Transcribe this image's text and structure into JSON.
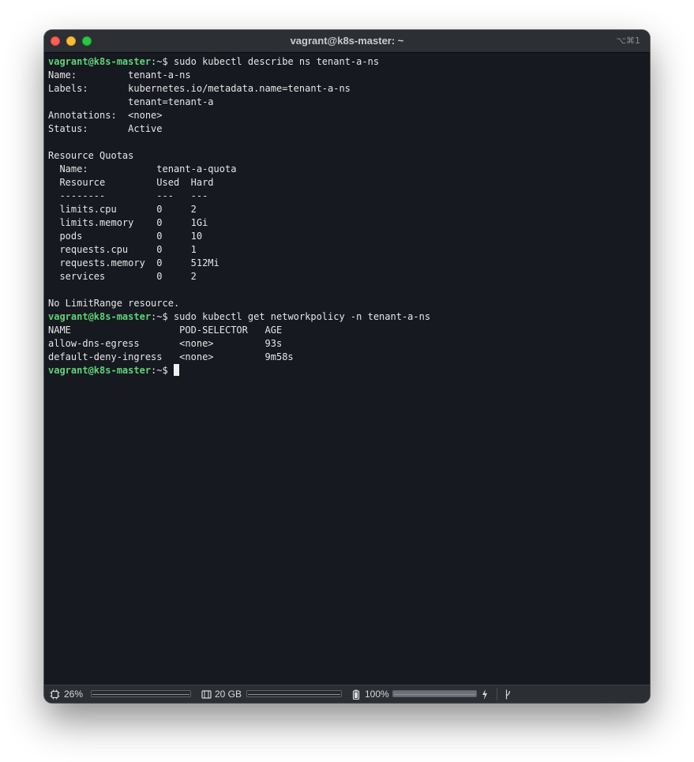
{
  "window": {
    "title": "vagrant@k8s-master: ~",
    "shortcut": "⌥⌘1"
  },
  "terminal": {
    "lines": [
      {
        "prompt": "vagrant@k8s-master",
        "path": ":~$ ",
        "command": "sudo kubectl describe ns tenant-a-ns"
      },
      {
        "text": "Name:         tenant-a-ns"
      },
      {
        "text": "Labels:       kubernetes.io/metadata.name=tenant-a-ns"
      },
      {
        "text": "              tenant=tenant-a"
      },
      {
        "text": "Annotations:  <none>"
      },
      {
        "text": "Status:       Active"
      },
      {
        "text": ""
      },
      {
        "text": "Resource Quotas"
      },
      {
        "text": "  Name:            tenant-a-quota"
      },
      {
        "text": "  Resource         Used  Hard"
      },
      {
        "text": "  --------         ---   ---"
      },
      {
        "text": "  limits.cpu       0     2"
      },
      {
        "text": "  limits.memory    0     1Gi"
      },
      {
        "text": "  pods             0     10"
      },
      {
        "text": "  requests.cpu     0     1"
      },
      {
        "text": "  requests.memory  0     512Mi"
      },
      {
        "text": "  services         0     2"
      },
      {
        "text": ""
      },
      {
        "text": "No LimitRange resource."
      },
      {
        "prompt": "vagrant@k8s-master",
        "path": ":~$ ",
        "command": "sudo kubectl get networkpolicy -n tenant-a-ns"
      },
      {
        "text": "NAME                   POD-SELECTOR   AGE"
      },
      {
        "text": "allow-dns-egress       <none>         93s"
      },
      {
        "text": "default-deny-ingress   <none>         9m58s"
      },
      {
        "prompt": "vagrant@k8s-master",
        "path": ":~$ ",
        "command": "",
        "cursor": true
      }
    ]
  },
  "statusbar": {
    "cpu_label": "26%",
    "cpu_icon": "cpu-chip-icon",
    "cpu_usage": 0.26,
    "disk_label": "20 GB",
    "disk_icon": "disk-icon",
    "battery_label": "100%",
    "battery_icon": "battery-icon",
    "battery_level": 1.0,
    "charging_icon": "lightning-bolt-icon",
    "branch_icon": "git-branch-icon"
  }
}
